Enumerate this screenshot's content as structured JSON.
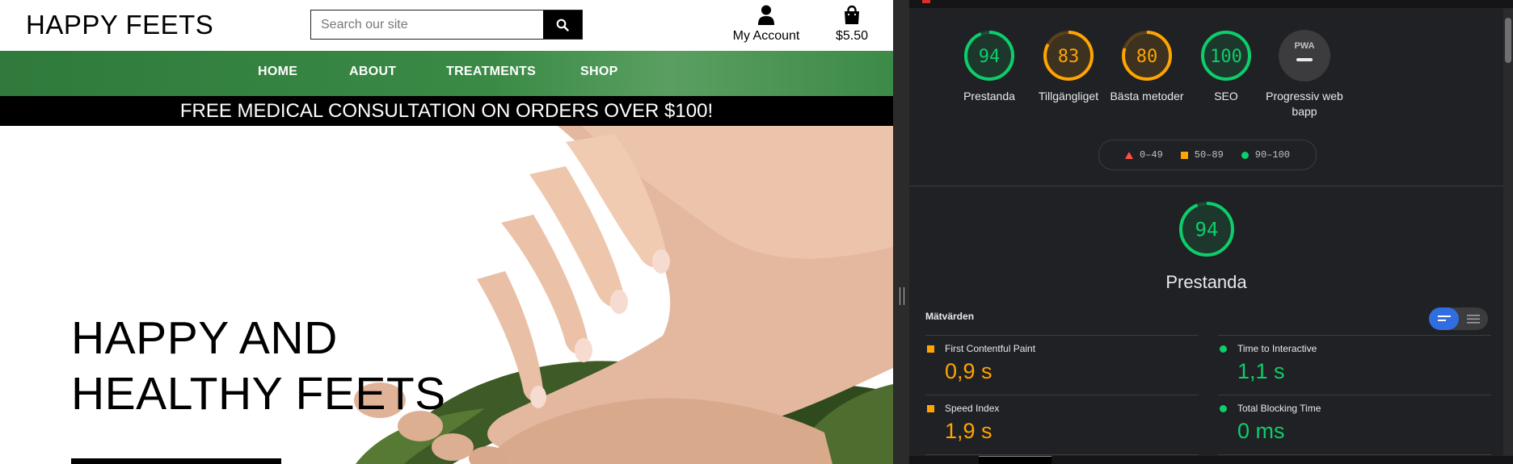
{
  "site": {
    "logo": "HAPPY FEETS",
    "search": {
      "placeholder": "Search our site",
      "value": ""
    },
    "account_label": "My Account",
    "bag_total": "$5.50",
    "nav": [
      "HOME",
      "ABOUT",
      "TREATMENTS",
      "SHOP"
    ],
    "promo": "FREE MEDICAL CONSULTATION ON ORDERS OVER $100!",
    "hero_title_line1": "HAPPY AND",
    "hero_title_line2": "HEALTHY FEETS"
  },
  "lighthouse": {
    "scores": [
      {
        "value": "94",
        "label": "Prestanda",
        "fraction": 0.94,
        "color": "#0cce6b"
      },
      {
        "value": "83",
        "label": "Tillgängliget",
        "fraction": 0.83,
        "color": "#ffa400"
      },
      {
        "value": "80",
        "label": "Bästa metoder",
        "fraction": 0.8,
        "color": "#ffa400"
      },
      {
        "value": "100",
        "label": "SEO",
        "fraction": 1.0,
        "color": "#0cce6b"
      },
      {
        "value": "PWA",
        "label": "Progressiv webbapp",
        "fraction": 0,
        "color": "#9aa0a6"
      }
    ],
    "legend": {
      "low": "0–49",
      "mid": "50–89",
      "high": "90–100"
    },
    "main_score": {
      "value": "94",
      "fraction": 0.94,
      "label": "Prestanda"
    },
    "metrics_heading": "Mätvärden",
    "metrics": [
      {
        "name": "First Contentful Paint",
        "value": "0,9 s",
        "status": "average"
      },
      {
        "name": "Time to Interactive",
        "value": "1,1 s",
        "status": "pass"
      },
      {
        "name": "Speed Index",
        "value": "1,9 s",
        "status": "average"
      },
      {
        "name": "Total Blocking Time",
        "value": "0 ms",
        "status": "pass"
      }
    ],
    "colors": {
      "pass": "#0cce6b",
      "average": "#ffa400",
      "fail": "#ff4e42",
      "bg": "#202124"
    }
  }
}
